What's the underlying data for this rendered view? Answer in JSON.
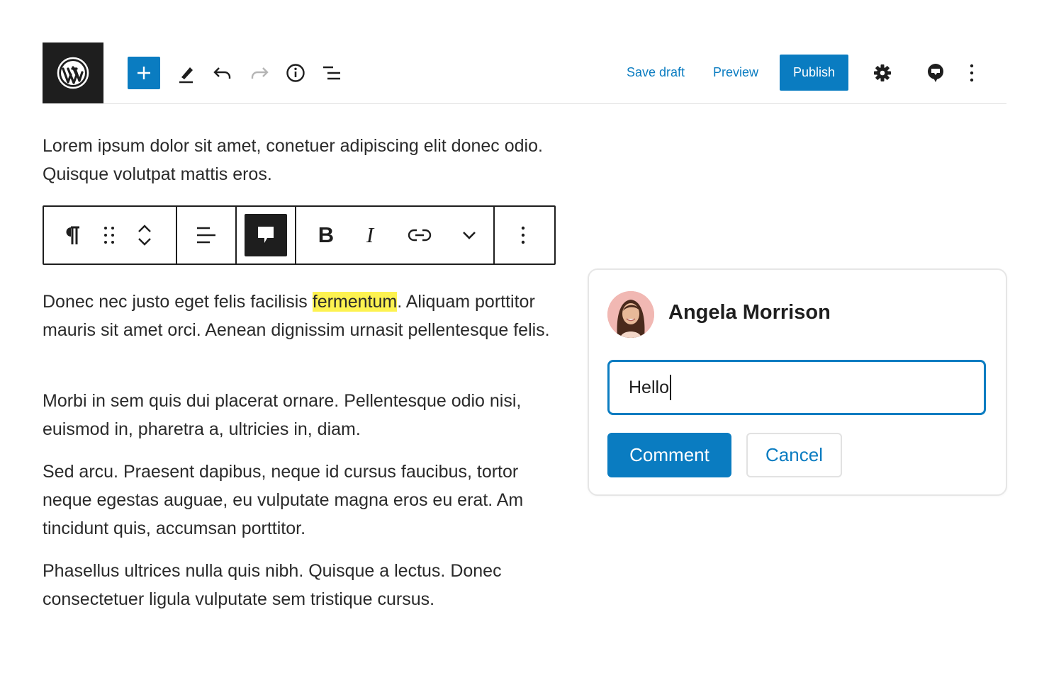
{
  "header": {
    "logo_icon": "wordpress-logo-icon",
    "tools": [
      "add-block-icon",
      "edit-pencil-icon",
      "undo-icon",
      "redo-icon",
      "info-icon",
      "list-view-icon"
    ],
    "save_draft_label": "Save draft",
    "preview_label": "Preview",
    "publish_label": "Publish",
    "right_icons": [
      "settings-gear-icon",
      "comments-icon",
      "more-options-icon"
    ]
  },
  "block_toolbar": {
    "groups": [
      [
        "paragraph-icon",
        "drag-handle-icon",
        "move-up-down-icon"
      ],
      [
        "align-icon"
      ],
      [
        "add-comment-icon"
      ],
      [
        "bold-icon",
        "italic-icon",
        "link-icon",
        "chevron-down-icon"
      ],
      [
        "more-options-icon"
      ]
    ],
    "bold_label": "B",
    "italic_label": "I"
  },
  "content": {
    "p1": "Lorem ipsum dolor sit amet, conetuer adipiscing elit donec odio. Quisque volutpat mattis eros.",
    "p2_before": "Donec nec justo eget felis facilisis ",
    "p2_highlight": "fermentum",
    "p2_after": ". Aliquam porttitor mauris sit amet orci. Aenean dignissim urnasit pellentesque felis.",
    "p3": "Morbi in sem quis dui placerat ornare. Pellentesque odio nisi, euismod in, pharetra a, ultricies in, diam.",
    "p4": "Sed arcu. Praesent dapibus, neque id cursus faucibus, tortor neque egestas auguae, eu vulputate magna eros eu erat. Am tincidunt quis, accumsan porttitor.",
    "p5": "Phasellus ultrices nulla quis nibh. Quisque a lectus. Donec consectetuer ligula vulputate sem tristique cursus."
  },
  "comment_panel": {
    "author": "Angela Morrison",
    "input_value": "Hello",
    "comment_label": "Comment",
    "cancel_label": "Cancel"
  },
  "colors": {
    "accent": "#0a7cc1",
    "dark": "#1e1e1e",
    "highlight": "#fdf250"
  }
}
